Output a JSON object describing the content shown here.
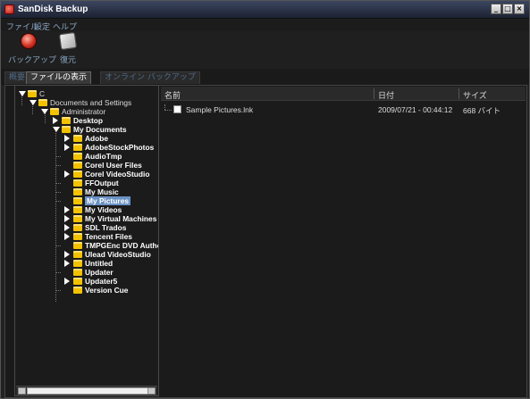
{
  "window": {
    "title": "SanDisk Backup",
    "controls": [
      "_",
      "□",
      "×"
    ]
  },
  "menu": [
    "ファイル",
    "設定",
    "ヘルプ"
  ],
  "toolbar": {
    "backup_label": "バックアップ",
    "restore_label": "復元"
  },
  "tabs": [
    {
      "label": "概要",
      "active": false
    },
    {
      "label": "ファイルの表示",
      "active": true
    },
    {
      "label": "オンライン バックアップ",
      "active": false
    }
  ],
  "tree": {
    "root": "C",
    "documents_and_settings": "Documents and Settings",
    "administrator": "Administrator",
    "desktop": "Desktop",
    "my_documents": "My Documents",
    "children": [
      {
        "label": "Adobe",
        "expandable": true
      },
      {
        "label": "AdobeStockPhotos",
        "expandable": true
      },
      {
        "label": "AudioTmp",
        "expandable": false
      },
      {
        "label": "Corel User Files",
        "expandable": false
      },
      {
        "label": "Corel VideoStudio",
        "expandable": true
      },
      {
        "label": "FFOutput",
        "expandable": false
      },
      {
        "label": "My Music",
        "expandable": false
      },
      {
        "label": "My Pictures",
        "expandable": false,
        "selected": true
      },
      {
        "label": "My Videos",
        "expandable": true
      },
      {
        "label": "My Virtual Machines",
        "expandable": true
      },
      {
        "label": "SDL Trados",
        "expandable": true
      },
      {
        "label": "Tencent Files",
        "expandable": true
      },
      {
        "label": "TMPGEnc DVD Autho",
        "expandable": false
      },
      {
        "label": "Ulead VideoStudio",
        "expandable": true
      },
      {
        "label": "Untitled",
        "expandable": true
      },
      {
        "label": "Updater",
        "expandable": false
      },
      {
        "label": "Updater5",
        "expandable": true
      },
      {
        "label": "Version Cue",
        "expandable": false
      }
    ]
  },
  "filelist": {
    "columns": {
      "name": "名前",
      "date": "日付",
      "size": "サイズ"
    },
    "rows": [
      {
        "name": "Sample Pictures.lnk",
        "date": "2009/07/21 - 00:44:12",
        "size": "668 バイト"
      }
    ]
  },
  "colors": {
    "background": "#222222",
    "accent": "#6a92c4",
    "folder": "#f2c200",
    "menu_text": "#8aa6c6"
  }
}
